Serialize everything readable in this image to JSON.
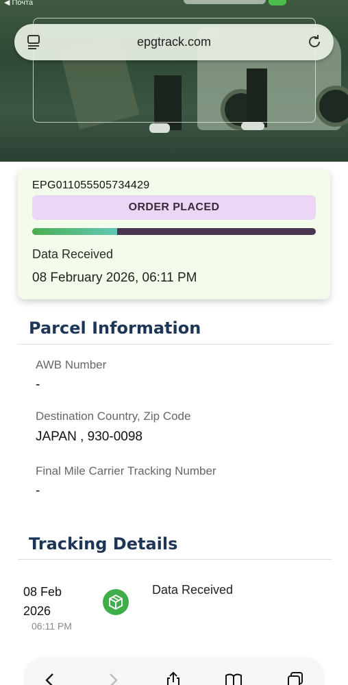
{
  "status_bar": {
    "back_app_label": "◀ Почта"
  },
  "browser": {
    "url": "epgtrack.com"
  },
  "tracking": {
    "number": "EPG011055505734429",
    "status_badge": "ORDER PLACED",
    "progress": 0.3,
    "status_label": "Data Received",
    "status_time": "08 February 2026, 06:11 PM"
  },
  "parcel_info": {
    "title": "Parcel Information",
    "fields": [
      {
        "label": "AWB Number",
        "value": "-"
      },
      {
        "label": "Destination Country, Zip Code",
        "value": "JAPAN , 930-0098"
      },
      {
        "label": "Final Mile Carrier Tracking Number",
        "value": "-"
      }
    ]
  },
  "tracking_details": {
    "title": "Tracking Details",
    "events": [
      {
        "date_line1": "08 Feb",
        "date_line2": "2026",
        "time": "06:11 PM",
        "event": "Data Received",
        "icon": "package-icon"
      }
    ]
  },
  "colors": {
    "accent_green": "#3fae49",
    "badge_purple": "#ecd6f5",
    "heading_navy": "#1d3557",
    "card_bg": "#f3fbea"
  },
  "toolbar_icons": [
    "back-icon",
    "forward-icon",
    "share-icon",
    "bookmarks-icon",
    "tabs-icon"
  ]
}
